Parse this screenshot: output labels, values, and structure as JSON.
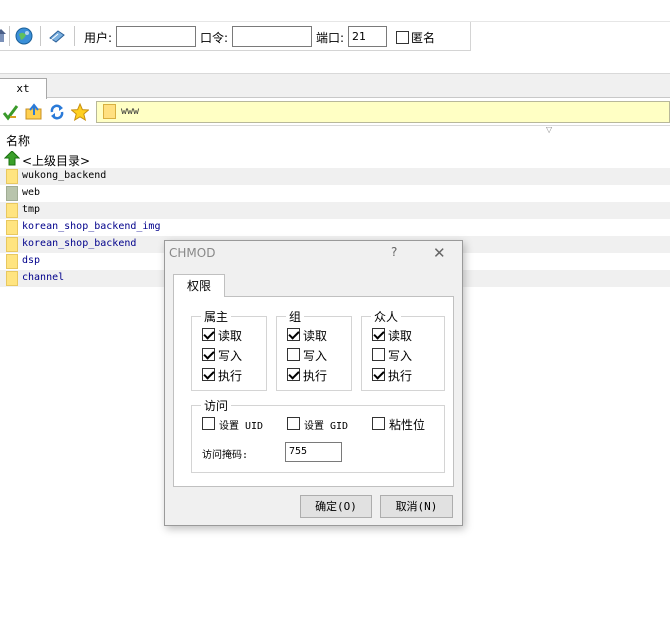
{
  "toolbar": {
    "user_label": "用户:",
    "user_value": "",
    "password_label": "口令:",
    "password_value": "",
    "port_label": "端口:",
    "port_value": "21",
    "anonymous_label": "匿名",
    "anonymous_checked": false
  },
  "tabs": [
    {
      "label": "xt"
    }
  ],
  "nav": {
    "path": "www"
  },
  "listing": {
    "column_header": "名称",
    "parent_dir_label": "<上级目录>",
    "items": [
      {
        "name": "wukong_backend",
        "alt": true,
        "folder": "yellow",
        "color": "black"
      },
      {
        "name": "web",
        "alt": false,
        "folder": "gray",
        "color": "black"
      },
      {
        "name": "tmp",
        "alt": true,
        "folder": "yellow",
        "color": "black"
      },
      {
        "name": "korean_shop_backend_img",
        "alt": false,
        "folder": "yellow",
        "color": "blue"
      },
      {
        "name": "korean_shop_backend",
        "alt": true,
        "folder": "yellow",
        "color": "blue"
      },
      {
        "name": "dsp",
        "alt": false,
        "folder": "yellow",
        "color": "blue"
      },
      {
        "name": "channel",
        "alt": true,
        "folder": "yellow",
        "color": "blue"
      }
    ]
  },
  "dialog": {
    "title": "CHMOD",
    "help_glyph": "?",
    "close_glyph": "✕",
    "tab_label": "权限",
    "owner": {
      "title": "属主",
      "read": "读取",
      "write": "写入",
      "execute": "执行",
      "read_checked": true,
      "write_checked": true,
      "execute_checked": true
    },
    "group": {
      "title": "组",
      "read": "读取",
      "write": "写入",
      "execute": "执行",
      "read_checked": true,
      "write_checked": false,
      "execute_checked": true
    },
    "others": {
      "title": "众人",
      "read": "读取",
      "write": "写入",
      "execute": "执行",
      "read_checked": true,
      "write_checked": false,
      "execute_checked": true
    },
    "access": {
      "title": "访问",
      "setuid_label": "设置 UID",
      "setgid_label": "设置 GID",
      "sticky_label": "粘性位",
      "setuid_checked": false,
      "setgid_checked": false,
      "sticky_checked": false,
      "mask_label": "访问掩码:",
      "mask_value": "755"
    },
    "ok_label": "确定(O)",
    "cancel_label": "取消(N)"
  },
  "colors": {
    "path_bg": "#ffffc4",
    "folder_yellow": "#ffe480",
    "folder_gray": "#b8c4ac",
    "link_blue": "#00008b",
    "alt_row": "#f0f0f0"
  }
}
